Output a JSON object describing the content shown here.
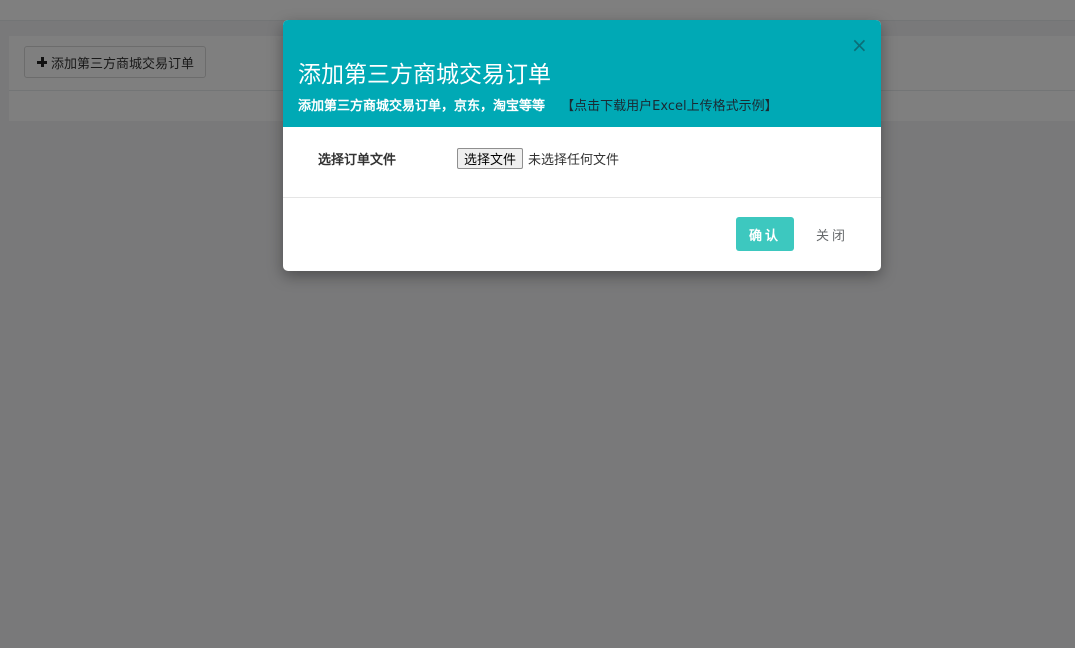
{
  "page": {
    "toolbar": {
      "add_button_label": "添加第三方商城交易订单",
      "add_button_icon": "plus-icon"
    }
  },
  "modal": {
    "title": "添加第三方商城交易订单",
    "subtitle": "添加第三方商城交易订单，京东，淘宝等等",
    "template_link": "【点击下载用户Excel上传格式示例】",
    "close_icon": "×",
    "body": {
      "file_label": "选择订单文件",
      "file_button_label": "选择文件",
      "file_status": "未选择任何文件"
    },
    "footer": {
      "confirm_label": "确认",
      "close_label": "关闭"
    }
  },
  "colors": {
    "header_bg": "#00a9b5",
    "confirm_bg": "#3dc8bf"
  }
}
